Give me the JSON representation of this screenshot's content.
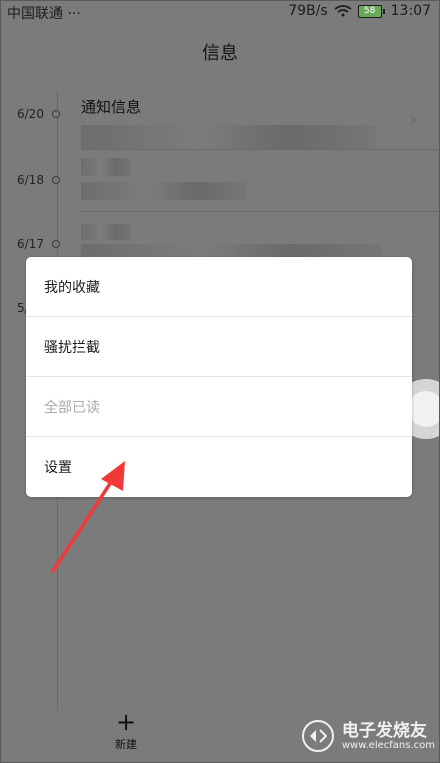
{
  "status_bar": {
    "carrier": "中国联通",
    "more": "···",
    "net_speed": "79B/s",
    "battery_level": "58",
    "time": "13:07"
  },
  "header": {
    "title": "信息"
  },
  "timeline": {
    "dates": [
      "6/20",
      "6/18",
      "6/17",
      "5/"
    ],
    "first_item_title": "通知信息"
  },
  "menu": {
    "items": [
      {
        "label": "我的收藏",
        "enabled": true
      },
      {
        "label": "骚扰拦截",
        "enabled": true
      },
      {
        "label": "全部已读",
        "enabled": false
      },
      {
        "label": "设置",
        "enabled": true
      }
    ]
  },
  "bottom": {
    "new_icon": "plus-icon",
    "new_label": "新建"
  },
  "watermark": {
    "title": "电子发烧友",
    "url": "www.elecfans.com"
  },
  "colors": {
    "overlay": "#7b7b7b",
    "menu_bg": "#ffffff",
    "arrow": "#f03a3a",
    "disabled_text": "#a8a8a8"
  }
}
